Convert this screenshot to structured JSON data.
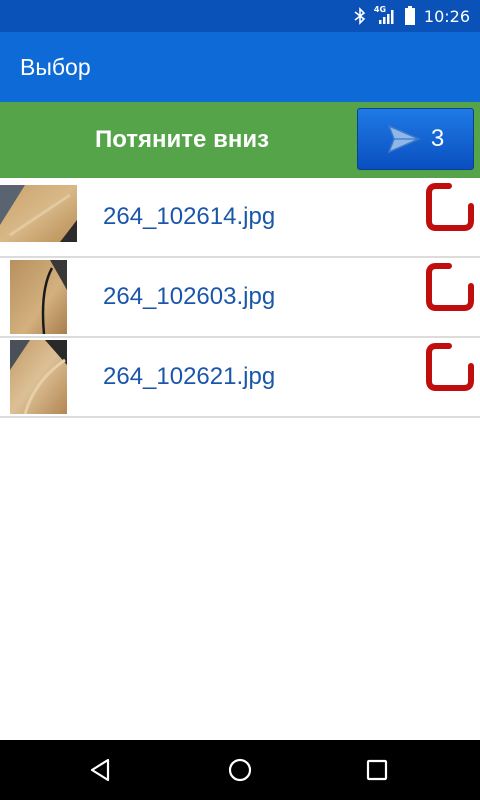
{
  "status_bar": {
    "time": "10:26",
    "network": "4G"
  },
  "app_bar": {
    "title": "Выбор"
  },
  "action_bar": {
    "pull_label": "Потяните вниз",
    "send_count": "3"
  },
  "files": [
    {
      "name": "264_102614.jpg"
    },
    {
      "name": "264_102603.jpg"
    },
    {
      "name": "264_102621.jpg"
    }
  ],
  "colors": {
    "status_bar": "#0a52b8",
    "app_bar": "#0d6ad6",
    "action_bar": "#55a44a",
    "file_text": "#1b57a8",
    "delete_icon": "#c00d0d"
  }
}
